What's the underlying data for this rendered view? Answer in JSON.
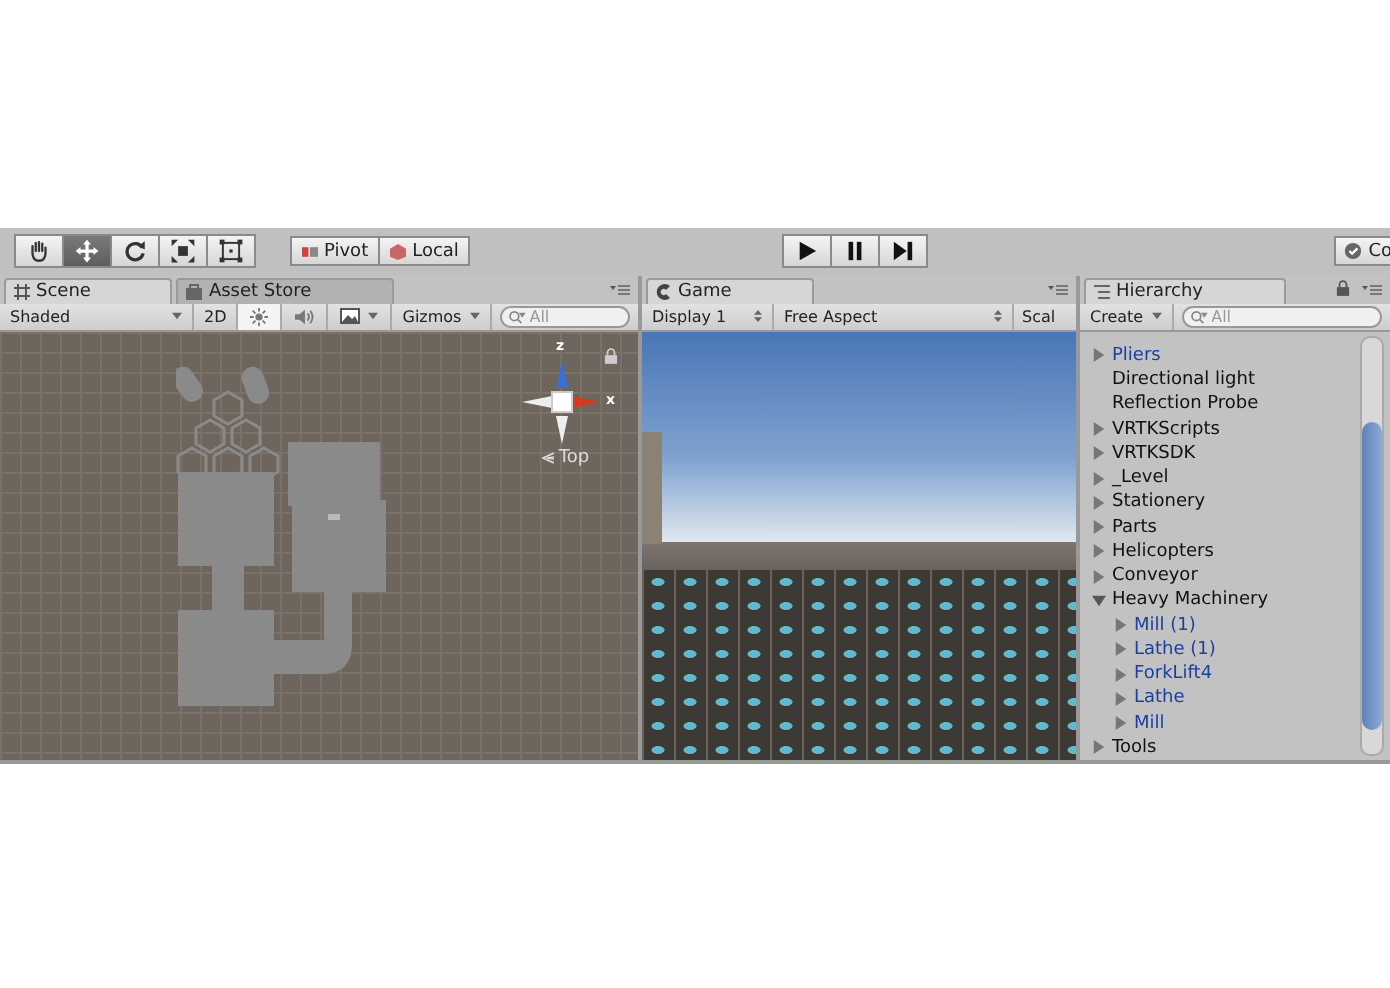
{
  "toolbar": {
    "tools": [
      {
        "kind": "hand",
        "selected": false
      },
      {
        "kind": "move",
        "selected": true
      },
      {
        "kind": "rotate",
        "selected": false
      },
      {
        "kind": "scale",
        "selected": false
      },
      {
        "kind": "rect",
        "selected": false
      }
    ],
    "pivot_buttons": [
      {
        "kind": "pivot",
        "label": "Pivot"
      },
      {
        "kind": "local",
        "label": "Local"
      }
    ],
    "play_controls": [
      {
        "kind": "play"
      },
      {
        "kind": "pause"
      },
      {
        "kind": "step"
      }
    ],
    "collab_button": {
      "label": "Co"
    }
  },
  "scene_panel": {
    "tabs": [
      {
        "kind": "scene",
        "label": "Scene",
        "selected": true
      },
      {
        "kind": "store",
        "label": "Asset Store",
        "selected": false
      }
    ],
    "shading": "Shaded",
    "mode_2d": "2D",
    "lighting_on": true,
    "audio_on": false,
    "gizmos": "Gizmos",
    "search": {
      "placeholder": "All"
    },
    "gizmo_axes": {
      "up": "z",
      "right": "x"
    },
    "view_label": "Top"
  },
  "game_panel": {
    "tab": {
      "label": "Game"
    },
    "display": "Display 1",
    "aspect": "Free Aspect",
    "scale": "Scal"
  },
  "hierarchy": {
    "tab": {
      "label": "Hierarchy"
    },
    "create": "Create",
    "search": {
      "placeholder": "All"
    },
    "items": [
      {
        "label": "Pliers",
        "prefab": true,
        "expanded": false
      },
      {
        "label": "Directional light",
        "prefab": false
      },
      {
        "label": "Reflection Probe",
        "prefab": false
      },
      {
        "label": "VRTKScripts",
        "prefab": false,
        "expanded": false
      },
      {
        "label": "VRTKSDK",
        "prefab": false,
        "expanded": false
      },
      {
        "label": "_Level",
        "prefab": false,
        "expanded": false
      },
      {
        "label": "Stationery",
        "prefab": false,
        "expanded": false
      },
      {
        "label": "Parts",
        "prefab": false,
        "expanded": false
      },
      {
        "label": "Helicopters",
        "prefab": false,
        "expanded": false
      },
      {
        "label": "Conveyor",
        "prefab": false,
        "expanded": false
      },
      {
        "label": "Heavy Machinery",
        "prefab": false,
        "expanded": true,
        "children": [
          {
            "label": "Mill (1)",
            "prefab": true,
            "expanded": false
          },
          {
            "label": "Lathe (1)",
            "prefab": true,
            "expanded": false
          },
          {
            "label": "ForkLift4",
            "prefab": true,
            "expanded": false
          },
          {
            "label": "Lathe",
            "prefab": true,
            "expanded": false
          },
          {
            "label": "Mill",
            "prefab": true,
            "expanded": false
          }
        ]
      },
      {
        "label": "Tools",
        "prefab": false,
        "expanded": false
      }
    ]
  }
}
